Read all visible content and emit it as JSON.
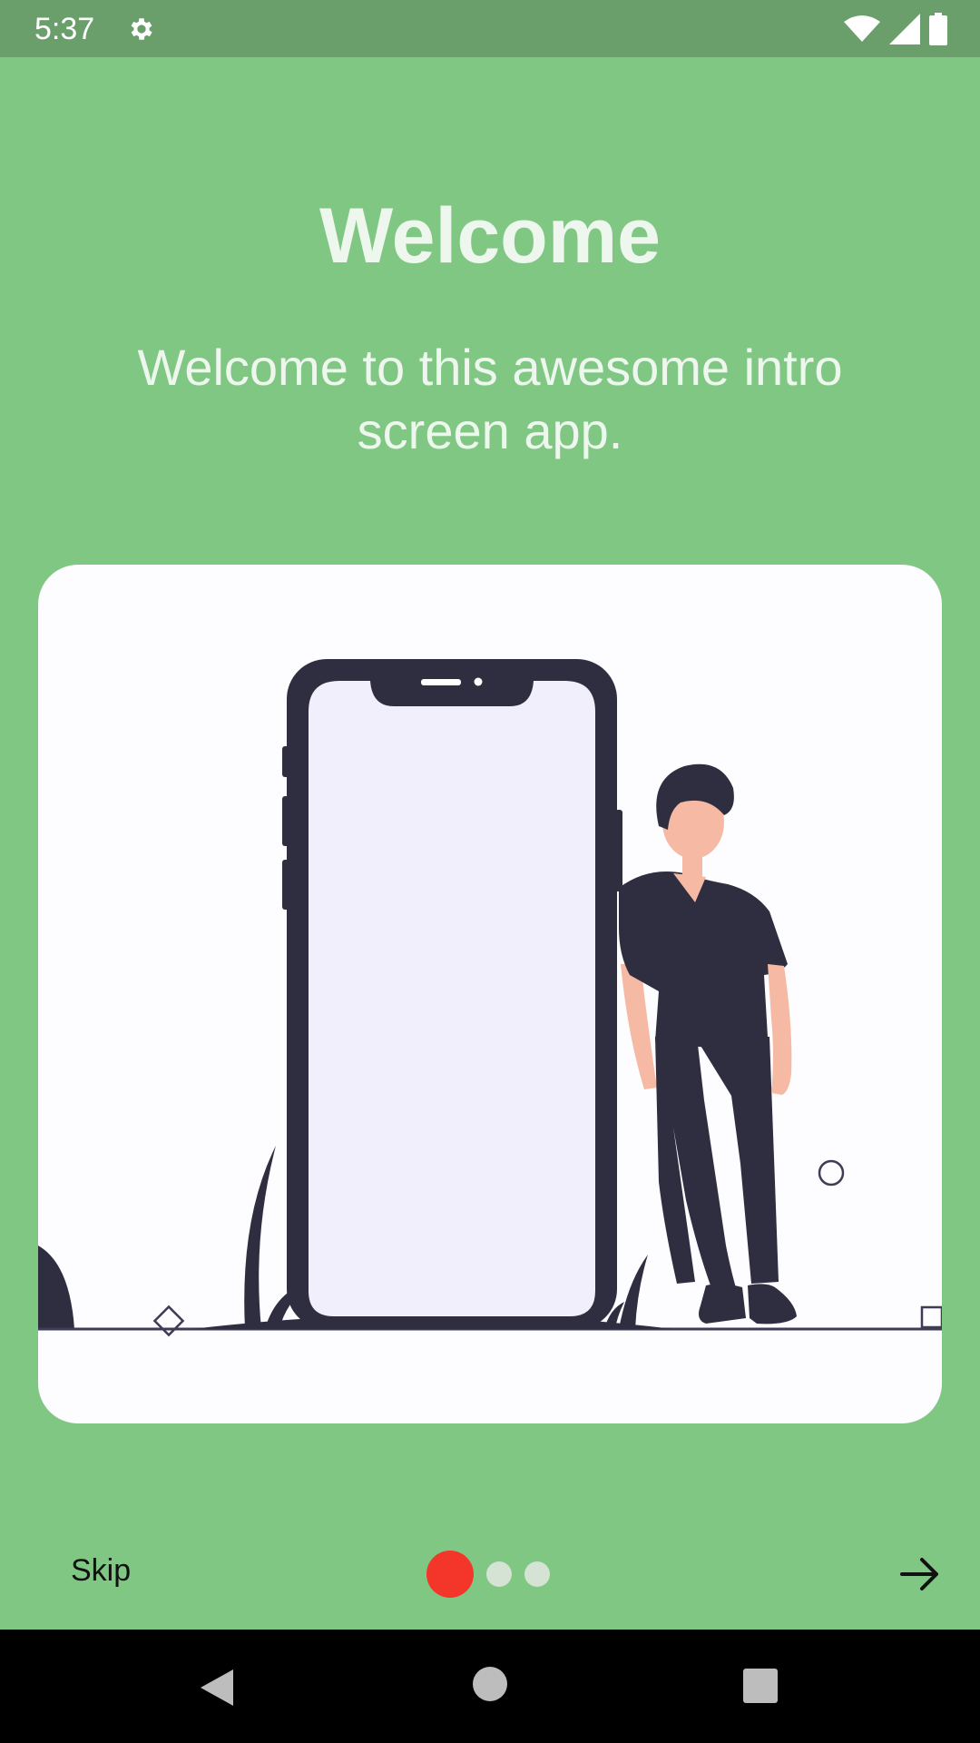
{
  "status_bar": {
    "time": "5:37",
    "icons": [
      "gear-icon",
      "wifi-icon",
      "signal-icon",
      "battery-icon"
    ]
  },
  "intro": {
    "title": "Welcome",
    "description": "Welcome to this awesome intro screen app.",
    "illustration": "person-leaning-on-phone-illustration"
  },
  "controls": {
    "skip_label": "Skip",
    "next_icon": "arrow-right-icon",
    "page_count": 3,
    "active_page": 1
  },
  "navigation_bar": {
    "buttons": [
      "back-icon",
      "home-icon",
      "recents-icon"
    ]
  },
  "colors": {
    "background": "#81c784",
    "status_bar": "#6a9f6c",
    "active_dot": "#f4362a",
    "inactive_dot": "#d4e3d4",
    "title_text": "#eef7ee",
    "card": "#fdfcff",
    "illustration_dark": "#2f2e41",
    "skin": "#f5b9a4"
  }
}
